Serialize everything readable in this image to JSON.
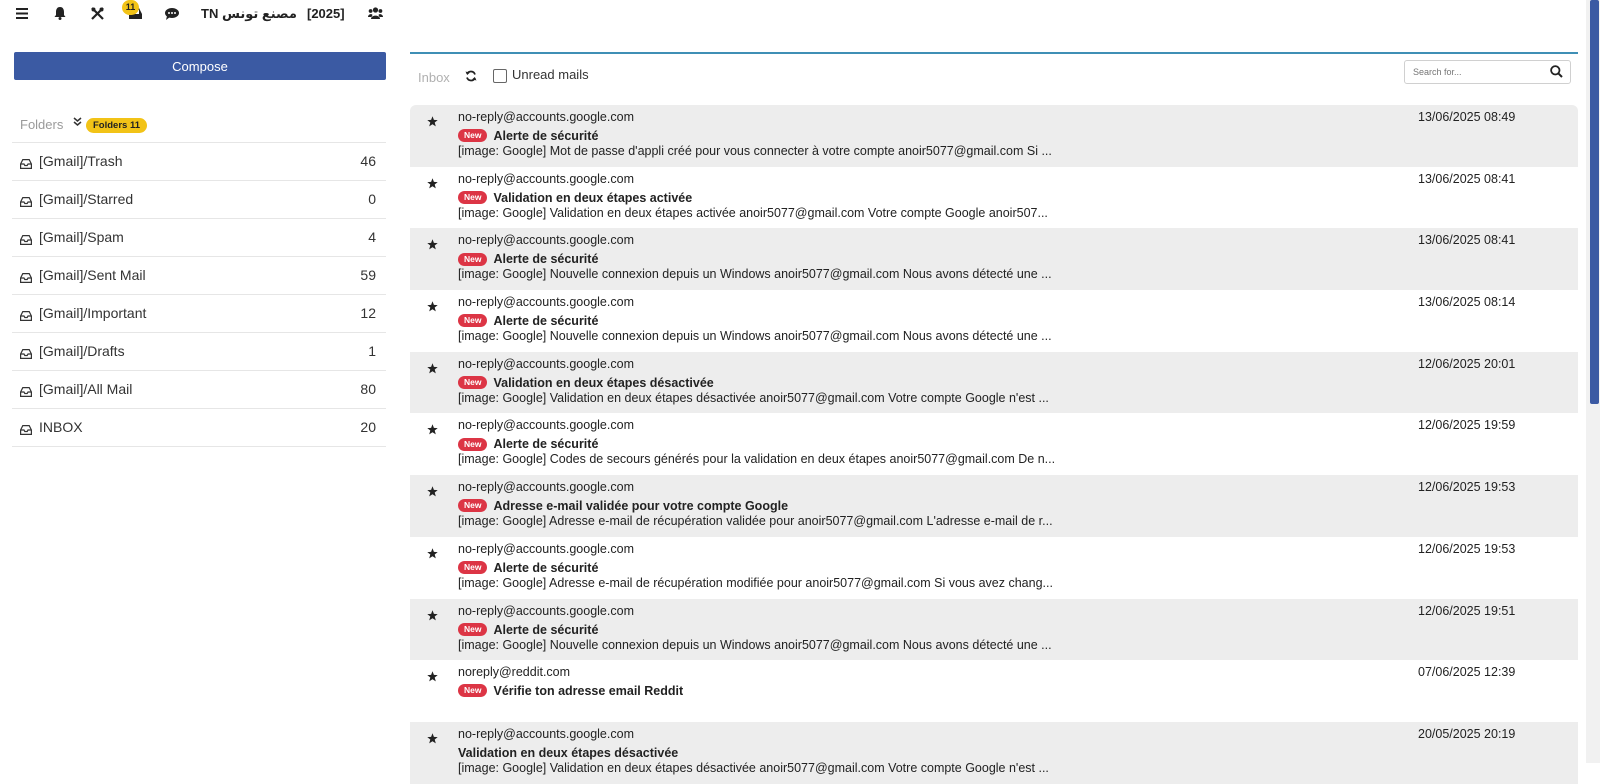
{
  "topbar": {
    "notification_count": "11",
    "tenant": "TN مصنع تونس",
    "year": "[2025]"
  },
  "sidebar": {
    "compose_label": "Compose",
    "folders_label": "Folders",
    "folders_badge": "Folders 11",
    "folders": [
      {
        "name": "[Gmail]/Trash",
        "count": "46"
      },
      {
        "name": "[Gmail]/Starred",
        "count": "0"
      },
      {
        "name": "[Gmail]/Spam",
        "count": "4"
      },
      {
        "name": "[Gmail]/Sent Mail",
        "count": "59"
      },
      {
        "name": "[Gmail]/Important",
        "count": "12"
      },
      {
        "name": "[Gmail]/Drafts",
        "count": "1"
      },
      {
        "name": "[Gmail]/All Mail",
        "count": "80"
      },
      {
        "name": "INBOX",
        "count": "20"
      }
    ]
  },
  "toolbar": {
    "inbox_label": "Inbox",
    "unread_label": "Unread mails",
    "search_placeholder": "Search for..."
  },
  "new_label": "New",
  "messages": [
    {
      "sender": "no-reply@accounts.google.com",
      "date": "13/06/2025 08:49",
      "is_new": true,
      "subject": "Alerte de sécurité",
      "preview": "[image: Google] Mot de passe d'appli créé pour vous connecter à votre compte anoir5077@gmail.com Si ..."
    },
    {
      "sender": "no-reply@accounts.google.com",
      "date": "13/06/2025 08:41",
      "is_new": true,
      "subject": "Validation en deux étapes activée",
      "preview": "[image: Google] Validation en deux étapes activée anoir5077@gmail.com Votre compte Google anoir507..."
    },
    {
      "sender": "no-reply@accounts.google.com",
      "date": "13/06/2025 08:41",
      "is_new": true,
      "subject": "Alerte de sécurité",
      "preview": "[image: Google] Nouvelle connexion depuis un Windows anoir5077@gmail.com Nous avons détecté une ..."
    },
    {
      "sender": "no-reply@accounts.google.com",
      "date": "13/06/2025 08:14",
      "is_new": true,
      "subject": "Alerte de sécurité",
      "preview": "[image: Google] Nouvelle connexion depuis un Windows anoir5077@gmail.com Nous avons détecté une ..."
    },
    {
      "sender": "no-reply@accounts.google.com",
      "date": "12/06/2025 20:01",
      "is_new": true,
      "subject": "Validation en deux étapes désactivée",
      "preview": "[image: Google] Validation en deux étapes désactivée anoir5077@gmail.com Votre compte Google n'est ..."
    },
    {
      "sender": "no-reply@accounts.google.com",
      "date": "12/06/2025 19:59",
      "is_new": true,
      "subject": "Alerte de sécurité",
      "preview": "[image: Google] Codes de secours générés pour la validation en deux étapes anoir5077@gmail.com De n..."
    },
    {
      "sender": "no-reply@accounts.google.com",
      "date": "12/06/2025 19:53",
      "is_new": true,
      "subject": "Adresse e-mail validée pour votre compte Google",
      "preview": "[image: Google] Adresse e-mail de récupération validée pour anoir5077@gmail.com L'adresse e-mail de r..."
    },
    {
      "sender": "no-reply@accounts.google.com",
      "date": "12/06/2025 19:53",
      "is_new": true,
      "subject": "Alerte de sécurité",
      "preview": "[image: Google] Adresse e-mail de récupération modifiée pour anoir5077@gmail.com Si vous avez chang..."
    },
    {
      "sender": "no-reply@accounts.google.com",
      "date": "12/06/2025 19:51",
      "is_new": true,
      "subject": "Alerte de sécurité",
      "preview": "[image: Google] Nouvelle connexion depuis un Windows anoir5077@gmail.com Nous avons détecté une ..."
    },
    {
      "sender": "noreply@reddit.com",
      "date": "07/06/2025 12:39",
      "is_new": true,
      "subject": "Vérifie ton adresse email Reddit",
      "preview": ""
    },
    {
      "sender": "no-reply@accounts.google.com",
      "date": "20/05/2025 20:19",
      "is_new": false,
      "subject": "Validation en deux étapes désactivée",
      "preview": "[image: Google] Validation en deux étapes désactivée anoir5077@gmail.com Votre compte Google n'est ..."
    }
  ],
  "colors": {
    "primary": "#3b5aa3",
    "badge_yellow": "#f2c317",
    "new_red": "#dc3545",
    "accent_line": "#3f8fb5"
  }
}
